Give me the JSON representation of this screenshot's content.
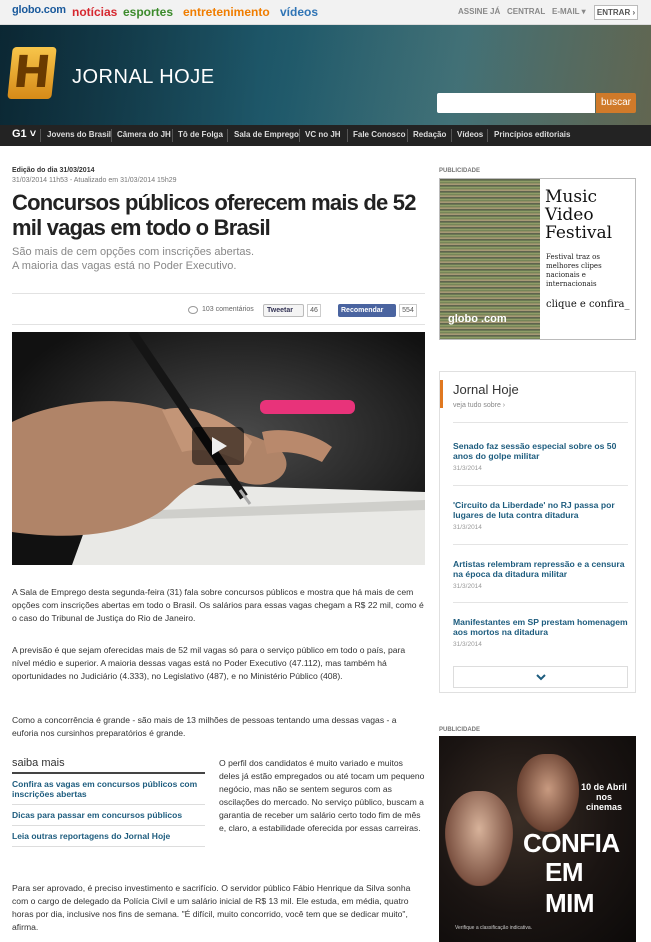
{
  "topbar": {
    "logo": "globo.com",
    "nav": [
      {
        "label": "notícias",
        "color": "#d6272e"
      },
      {
        "label": "esportes",
        "color": "#3c8b2c"
      },
      {
        "label": "entretenimento",
        "color": "#f07d00"
      },
      {
        "label": "vídeos",
        "color": "#2f74b5"
      }
    ],
    "links": [
      "ASSINE JÁ",
      "CENTRAL",
      "E-MAIL ▾"
    ],
    "login": "ENTRAR ›"
  },
  "header": {
    "show_logo": "H",
    "show_title": "JORNAL HOJE",
    "search_button": "buscar"
  },
  "subnav": {
    "brand": "G1 ˅",
    "items": [
      "Jovens do Brasil",
      "Câmera do JH",
      "Tô de Folga",
      "Sala de Emprego",
      "VC no JH",
      "Fale Conosco",
      "Redação",
      "Vídeos",
      "Princípios editoriais"
    ]
  },
  "article": {
    "edition": "Edição do dia 31/03/2014",
    "timestamp": "31/03/2014 11h53 - Atualizado em 31/03/2014 15h29",
    "headline": "Concursos públicos oferecem mais de 52 mil vagas em todo o Brasil",
    "subhead_1": "São mais de cem opções com inscrições abertas.",
    "subhead_2": "A maioria das vagas está no Poder Executivo.",
    "comments": "103 comentários",
    "tweet": "Tweetar",
    "tweet_count": "46",
    "recommend": "Recomendar",
    "recommend_count": "554",
    "paragraphs": [
      "A Sala de Emprego desta segunda-feira (31) fala sobre concursos públicos e mostra que há mais de cem opções com inscrições abertas em todo o Brasil. Os salários para essas vagas chegam a R$ 22 mil, como é o caso do Tribunal de Justiça do Rio de Janeiro.",
      "A previsão é que sejam oferecidas mais de 52 mil vagas só para o serviço público em todo o país, para nível médio e superior. A maioria dessas vagas está no Poder Executivo (47.112), mas também há oportunidades no Judiciário (4.333), no Legislativo (487), e no Ministério Público (408).",
      "Como a concorrência é grande - são mais de 13 milhões de pessoas tentando uma dessas vagas - a euforia nos cursinhos preparatórios é grande."
    ],
    "side_paragraph": "O perfil dos candidatos é muito variado e muitos deles já estão empregados ou até tocam um pequeno negócio, mas não se sentem seguros com as oscilações do mercado. No serviço público, buscam a garantia de receber um salário certo todo fim de mês e, claro, a estabilidade oferecida por essas carreiras.",
    "last_paragraph": "Para ser aprovado, é preciso investimento e sacrifício. O servidor público Fábio Henrique da Silva sonha com o cargo de delegado da Polícia Civil e um salário inicial de R$ 13 mil. Ele estuda, em média, quatro horas por dia, inclusive nos fins de semana. \"É difícil, muito concorrido, você tem que se dedicar muito\", afirma."
  },
  "saiba_mais": {
    "title": "saiba mais",
    "links": [
      "Confira as vagas em concursos públicos com inscrições abertas",
      "Dicas para passar em concursos públicos",
      "Leia outras reportagens do Jornal Hoje"
    ]
  },
  "sidebar": {
    "ad_label_1": "PUBLICIDADE",
    "ad1": {
      "logo": "globo .com",
      "title": "Music Video Festival",
      "text": "Festival traz os melhores clipes nacionais e internacionais",
      "cta": "clique e confira_"
    },
    "jh": {
      "title": "Jornal Hoje",
      "more": "veja tudo sobre ›",
      "items": [
        {
          "headline": "Senado faz sessão especial sobre os 50 anos do golpe militar",
          "date": "31/3/2014"
        },
        {
          "headline": "'Circuito da Liberdade' no RJ passa por lugares de luta contra ditadura",
          "date": "31/3/2014"
        },
        {
          "headline": "Artistas relembram repressão e a censura na época da ditadura militar",
          "date": "31/3/2014"
        },
        {
          "headline": "Manifestantes em SP prestam homenagem aos mortos na ditadura",
          "date": "31/3/2014"
        }
      ]
    },
    "ad_label_2": "PUBLICIDADE",
    "ad2": {
      "date": "10 de Abril nos cinemas",
      "title_1": "CONFIA",
      "title_2": "EM MIM",
      "fine_print": "Verifique a classificação indicativa."
    }
  }
}
